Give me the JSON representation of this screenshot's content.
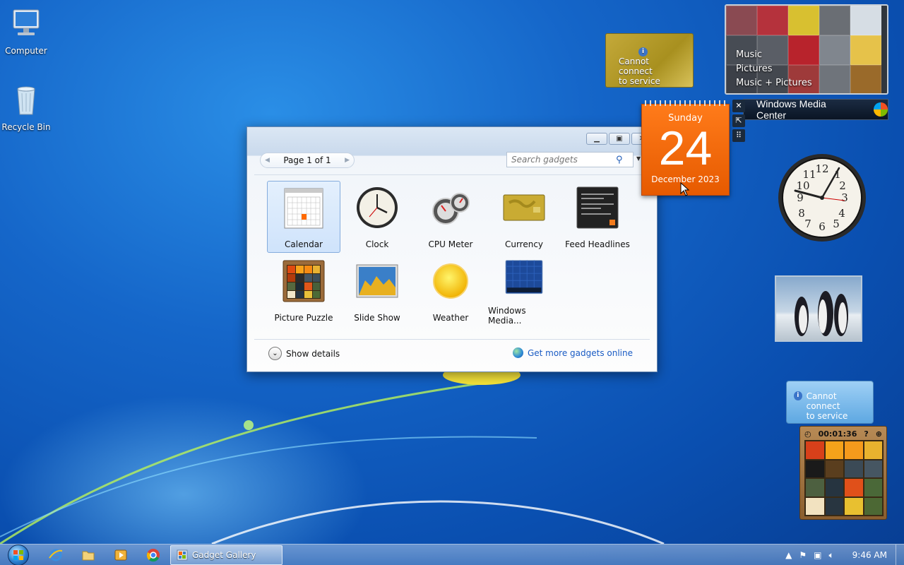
{
  "desktop": {
    "icons": [
      {
        "label": "Computer"
      },
      {
        "label": "Recycle Bin"
      }
    ]
  },
  "gallery_window": {
    "title": "Gadget Gallery",
    "pager": {
      "label": "Page 1 of 1"
    },
    "search": {
      "placeholder": "Search gadgets"
    },
    "gadgets": [
      {
        "name": "Calendar",
        "selected": true
      },
      {
        "name": "Clock"
      },
      {
        "name": "CPU Meter"
      },
      {
        "name": "Currency"
      },
      {
        "name": "Feed Headlines"
      },
      {
        "name": "Picture Puzzle"
      },
      {
        "name": "Slide Show"
      },
      {
        "name": "Weather"
      },
      {
        "name": "Windows Media..."
      }
    ],
    "show_details": "Show details",
    "get_more": "Get more gadgets online"
  },
  "calendar_gadget": {
    "day_name": "Sunday",
    "day_number": "24",
    "month_year": "December 2023",
    "accent": "#ff6a00"
  },
  "currency_gadget": {
    "message_line1": "Cannot connect",
    "message_line2": "to service"
  },
  "media_center_gadget": {
    "menu": [
      "Music",
      "Pictures",
      "Music + Pictures"
    ],
    "brand": "Windows Media Center"
  },
  "weather_gadget": {
    "message_line1": "Cannot connect",
    "message_line2": "to service"
  },
  "puzzle_gadget": {
    "timer": "00:01:36"
  },
  "taskbar": {
    "active_task": "Gadget Gallery",
    "time": "9:46 AM"
  }
}
